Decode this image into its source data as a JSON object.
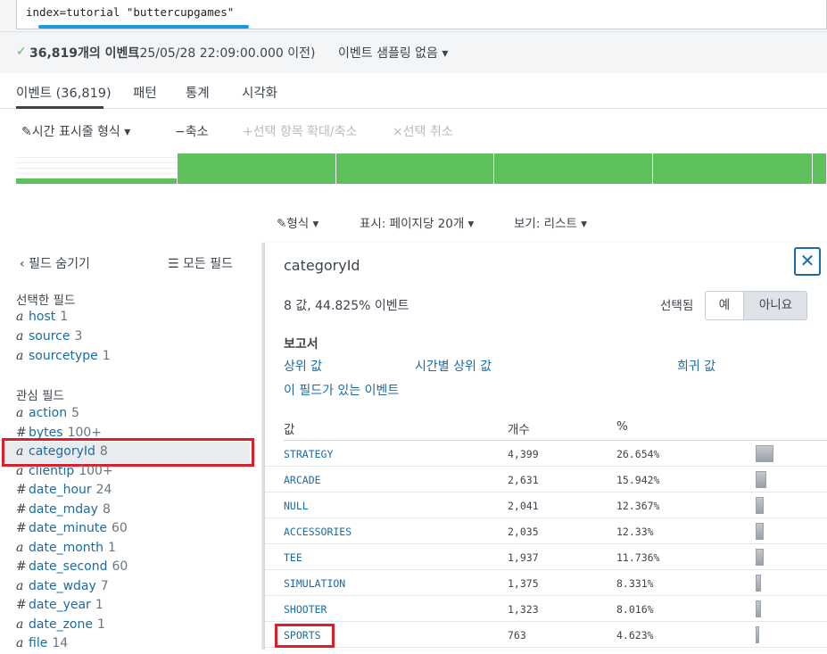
{
  "search": {
    "query": "index=tutorial \"buttercupgames\""
  },
  "status": {
    "count_text": "36,819개의 이벤트",
    "time_text": "(25/05/28 22:09:00.000 이전)",
    "sampling_text": "이벤트 샘플링 없음 ▾"
  },
  "tabs": [
    {
      "label": "이벤트 (36,819)"
    },
    {
      "label": "패턴"
    },
    {
      "label": "통계"
    },
    {
      "label": "시각화"
    }
  ],
  "timeline_toolbar": {
    "format_label": "시간 표시줄 형식 ▾",
    "zoom_out_label": "축소",
    "zoom_selection_label": "선택 항목 확대/축소",
    "deselect_label": "선택 취소"
  },
  "histogram": {
    "color": "#5cc05c",
    "bars": [
      0.18,
      1,
      1,
      1,
      1,
      1
    ]
  },
  "view_options": {
    "format_label": "형식 ▾",
    "display_label": "표시: 페이지당 20개 ▾",
    "view_label": "보기: 리스트 ▾"
  },
  "left_panel": {
    "hide_fields_label": "필드 숨기기",
    "all_fields_label": "모든 필드",
    "selected_heading": "선택한 필드",
    "selected_fields": [
      {
        "type": "a",
        "name": "host",
        "count": "1"
      },
      {
        "type": "a",
        "name": "source",
        "count": "3"
      },
      {
        "type": "a",
        "name": "sourcetype",
        "count": "1"
      }
    ],
    "interesting_heading": "관심 필드",
    "interesting_fields": [
      {
        "type": "a",
        "name": "action",
        "count": "5"
      },
      {
        "type": "#",
        "name": "bytes",
        "count": "100+"
      },
      {
        "type": "a",
        "name": "categoryId",
        "count": "8"
      },
      {
        "type": "a",
        "name": "clientip",
        "count": "100+"
      },
      {
        "type": "#",
        "name": "date_hour",
        "count": "24"
      },
      {
        "type": "#",
        "name": "date_mday",
        "count": "8"
      },
      {
        "type": "#",
        "name": "date_minute",
        "count": "60"
      },
      {
        "type": "a",
        "name": "date_month",
        "count": "1"
      },
      {
        "type": "#",
        "name": "date_second",
        "count": "60"
      },
      {
        "type": "a",
        "name": "date_wday",
        "count": "7"
      },
      {
        "type": "#",
        "name": "date_year",
        "count": "1"
      },
      {
        "type": "a",
        "name": "date_zone",
        "count": "1"
      },
      {
        "type": "a",
        "name": "file",
        "count": "14"
      }
    ]
  },
  "popover": {
    "title": "categoryId",
    "close_glyph": "✕",
    "summary": "8 값, 44.825% 이벤트",
    "selected_label": "선택됨",
    "toggle_yes": "예",
    "toggle_no": "아니요",
    "reports_heading": "보고서",
    "report_links": {
      "top_values": "상위 값",
      "top_values_by_time": "시간별 상위 값",
      "rare_values": "희귀 값",
      "events_with_field": "이 필드가 있는 이벤트"
    },
    "table": {
      "headers": {
        "value": "값",
        "count": "개수",
        "percent": "%"
      },
      "rows": [
        {
          "value": "STRATEGY",
          "count": "4,399",
          "percent": "26.654%",
          "pct": 26.654
        },
        {
          "value": "ARCADE",
          "count": "2,631",
          "percent": "15.942%",
          "pct": 15.942
        },
        {
          "value": "NULL",
          "count": "2,041",
          "percent": "12.367%",
          "pct": 12.367
        },
        {
          "value": "ACCESSORIES",
          "count": "2,035",
          "percent": "12.33%",
          "pct": 12.33
        },
        {
          "value": "TEE",
          "count": "1,937",
          "percent": "11.736%",
          "pct": 11.736
        },
        {
          "value": "SIMULATION",
          "count": "1,375",
          "percent": "8.331%",
          "pct": 8.331
        },
        {
          "value": "SHOOTER",
          "count": "1,323",
          "percent": "8.016%",
          "pct": 8.016
        },
        {
          "value": "SPORTS",
          "count": "763",
          "percent": "4.623%",
          "pct": 4.623
        }
      ]
    }
  },
  "highlight_color": "#e01e2a"
}
